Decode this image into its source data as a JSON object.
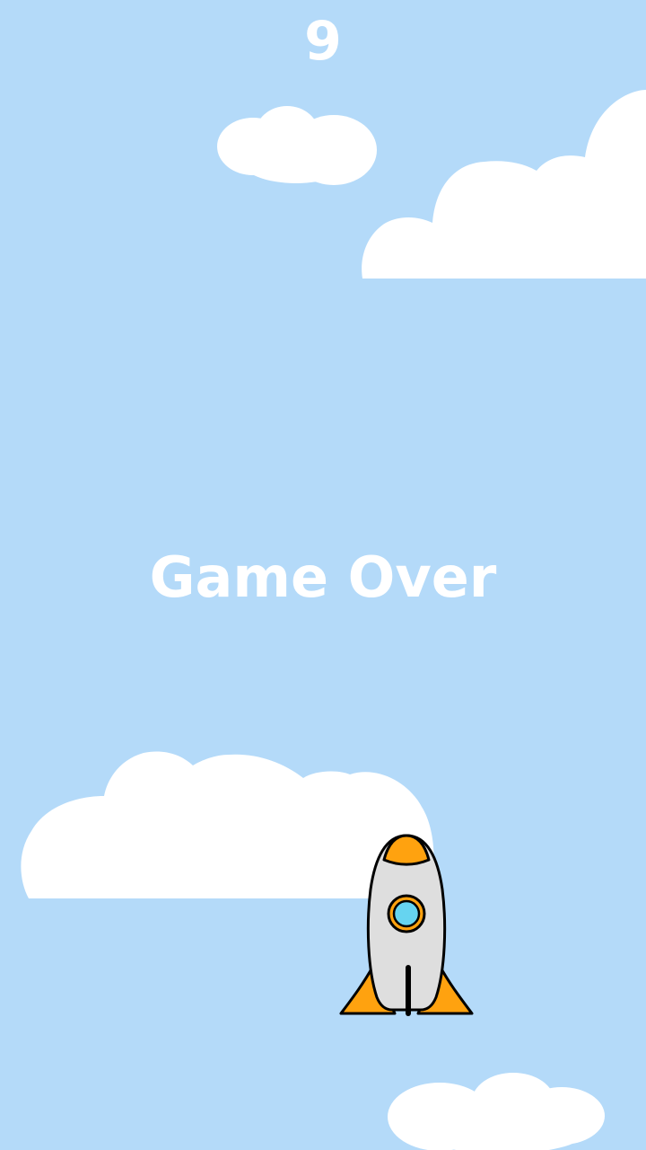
{
  "hud": {
    "score": "9"
  },
  "overlay": {
    "message": "Game Over"
  },
  "colors": {
    "sky": "#b4daf9",
    "cloud": "#ffffff",
    "rocket_body": "#dedede",
    "rocket_accent": "#ffa20f",
    "window_glass": "#66d4f0",
    "outline": "#000000"
  },
  "icons": {
    "player": "rocket-icon",
    "scenery": "cloud-icon"
  }
}
